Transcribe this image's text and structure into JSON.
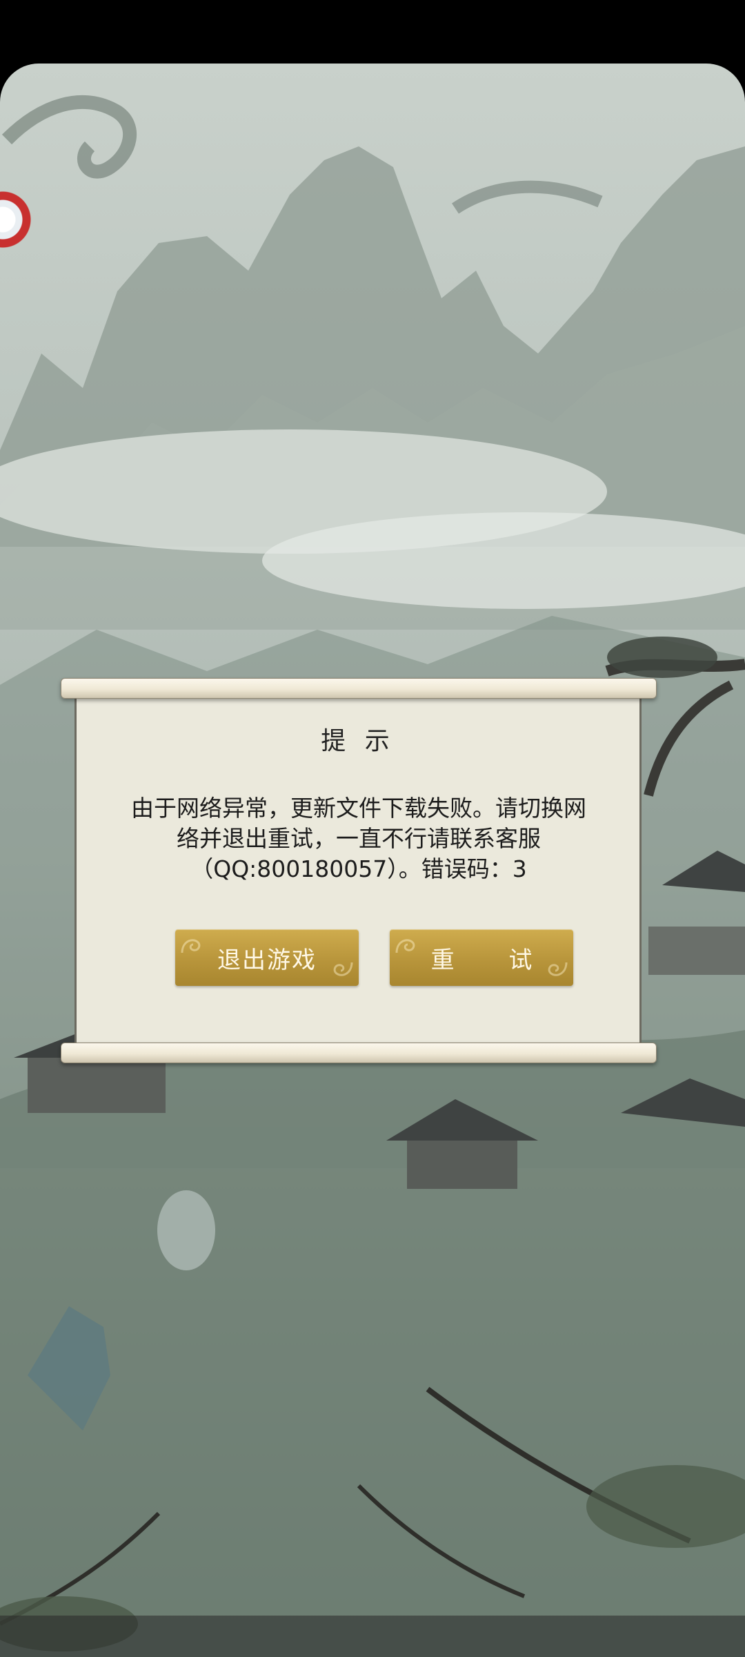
{
  "dialog": {
    "title": "提 示",
    "message": "由于网络异常，更新文件下载失败。请切换网络并退出重试，一直不行请联系客服（QQ:800180057）。错误码：3",
    "exit_button_label": "退出游戏",
    "retry_button_label": "重 试"
  },
  "colors": {
    "button_gold": "#b8953b",
    "paper": "#ebe9dc",
    "scroll_rod": "#efe8d5"
  }
}
